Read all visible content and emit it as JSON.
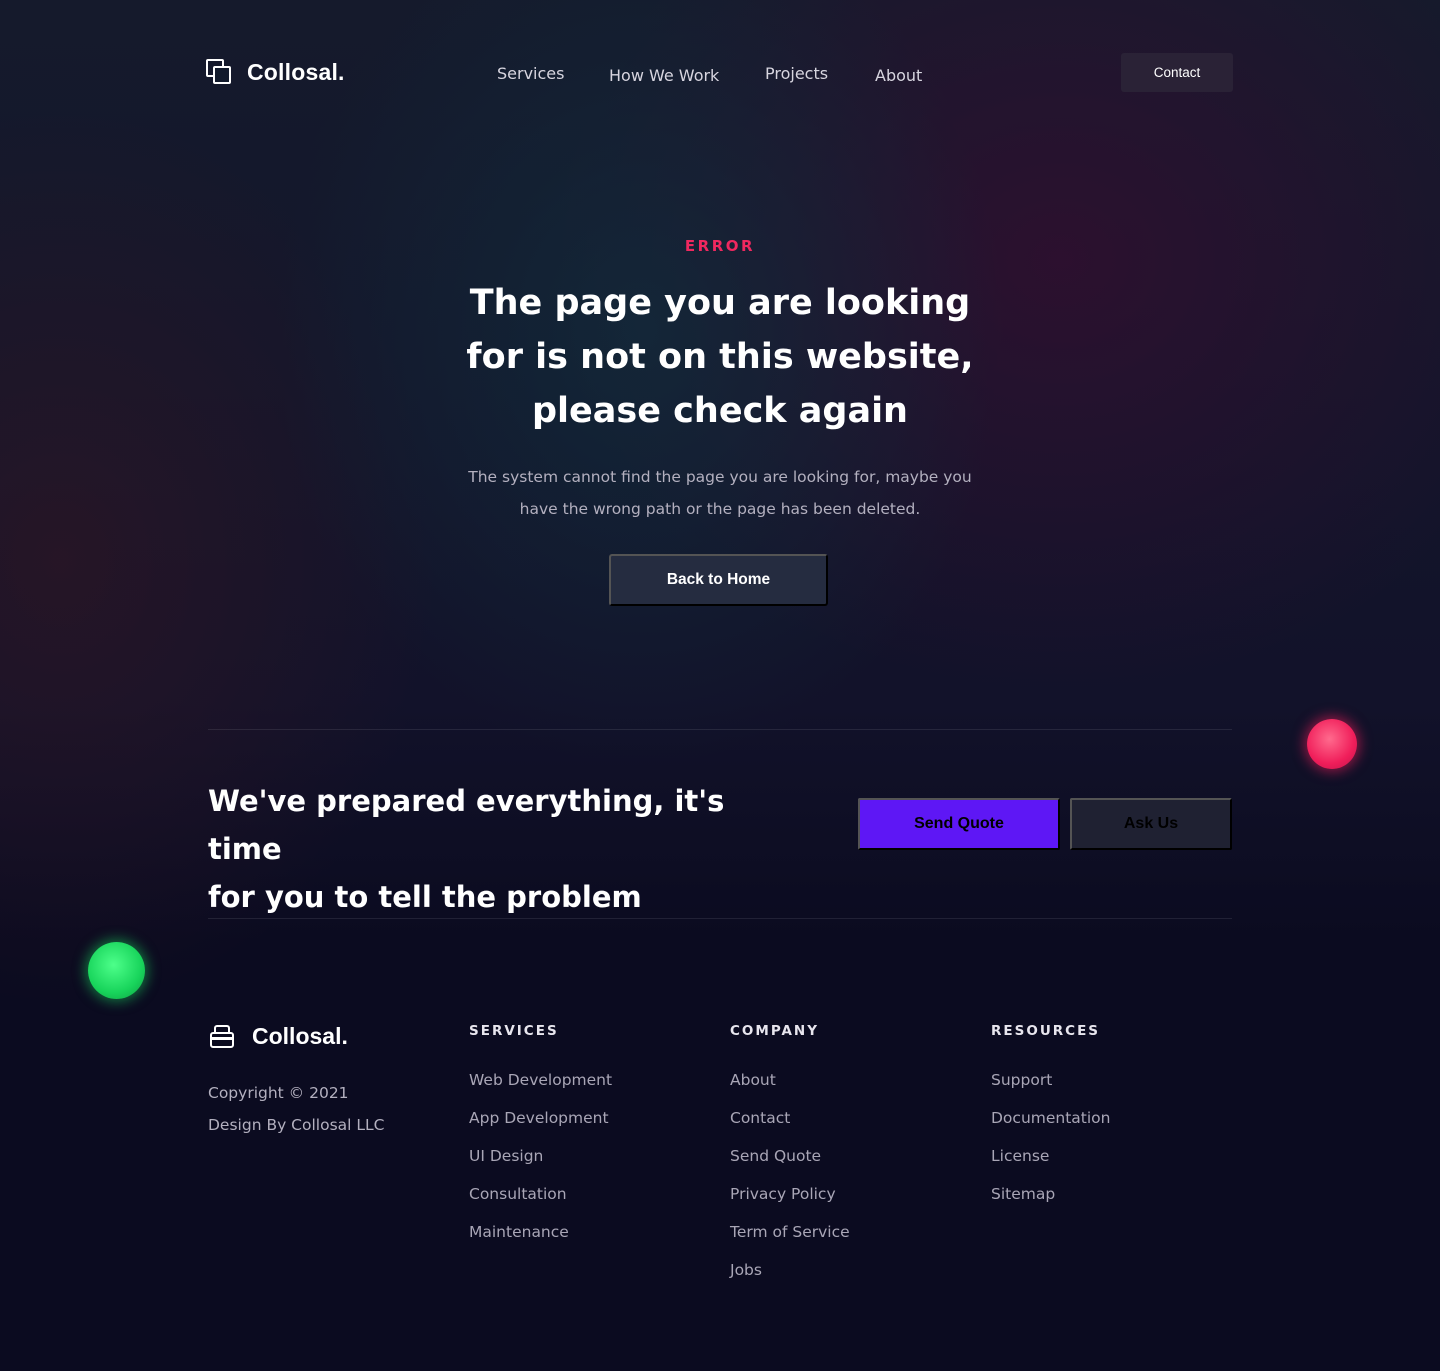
{
  "header": {
    "logo_text": "Collosal.",
    "nav": [
      "Services",
      "How We Work",
      "Projects",
      "About"
    ],
    "contact_label": "Contact"
  },
  "hero": {
    "eyebrow": "ERROR",
    "title_lines": [
      "The page you are looking",
      "for is not on this website,",
      "please check again"
    ],
    "description_lines": [
      "The system cannot find the page you are looking for, maybe you",
      "have the wrong path or the page has been deleted."
    ],
    "button_label": "Back to Home"
  },
  "cta": {
    "title_lines": [
      "We've prepared everything, it's time",
      "for you to tell the problem"
    ],
    "primary_label": "Send Quote",
    "secondary_label": "Ask Us"
  },
  "footer": {
    "logo_text": "Collosal.",
    "copyright": "Copyright © 2021",
    "credit": "Design By Collosal LLC",
    "columns": [
      {
        "heading": "SERVICES",
        "links": [
          "Web Development",
          "App Development",
          "UI Design",
          "Consultation",
          "Maintenance"
        ]
      },
      {
        "heading": "COMPANY",
        "links": [
          "About",
          "Contact",
          "Send Quote",
          "Privacy Policy",
          "Term of Service",
          "Jobs"
        ]
      },
      {
        "heading": "RESOURCES",
        "links": [
          "Support",
          "Documentation",
          "License",
          "Sitemap"
        ]
      }
    ]
  },
  "colors": {
    "accent_error": "#f0285f",
    "primary_button": "#5e17f5",
    "orb_pink": "#f01e5a",
    "orb_green": "#18d45b"
  }
}
